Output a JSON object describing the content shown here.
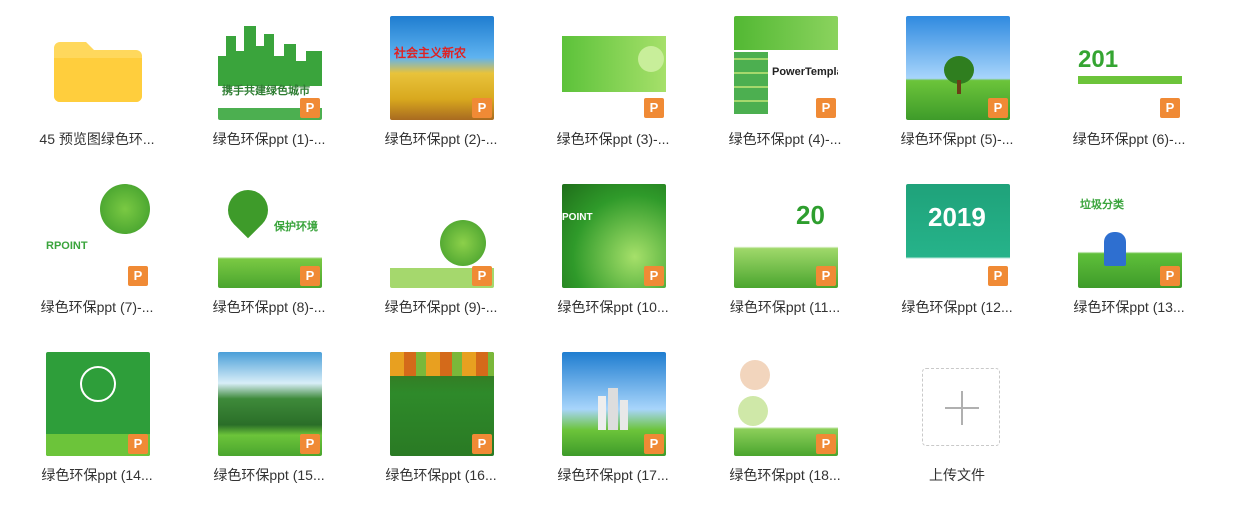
{
  "items": [
    {
      "label": "45 预览图绿色环...",
      "kind": "folder"
    },
    {
      "label": "绿色环保ppt (1)-...",
      "kind": "ppt",
      "overlay": "携手共建绿色城市"
    },
    {
      "label": "绿色环保ppt (2)-...",
      "kind": "ppt",
      "overlay": "社会主义新农"
    },
    {
      "label": "绿色环保ppt (3)-...",
      "kind": "ppt",
      "overlay": ""
    },
    {
      "label": "绿色环保ppt (4)-...",
      "kind": "ppt",
      "overlay": "PowerTempla"
    },
    {
      "label": "绿色环保ppt (5)-...",
      "kind": "ppt",
      "overlay": ""
    },
    {
      "label": "绿色环保ppt (6)-...",
      "kind": "ppt",
      "overlay": "201"
    },
    {
      "label": "绿色环保ppt (7)-...",
      "kind": "ppt",
      "overlay": "RPOINT"
    },
    {
      "label": "绿色环保ppt (8)-...",
      "kind": "ppt",
      "overlay": "保护环境"
    },
    {
      "label": "绿色环保ppt (9)-...",
      "kind": "ppt",
      "overlay": ""
    },
    {
      "label": "绿色环保ppt (10...",
      "kind": "ppt",
      "overlay": "POINT"
    },
    {
      "label": "绿色环保ppt (11...",
      "kind": "ppt",
      "overlay": "20"
    },
    {
      "label": "绿色环保ppt (12...",
      "kind": "ppt",
      "overlay": "2019"
    },
    {
      "label": "绿色环保ppt (13...",
      "kind": "ppt",
      "overlay": "垃圾分类"
    },
    {
      "label": "绿色环保ppt (14...",
      "kind": "ppt",
      "overlay": ""
    },
    {
      "label": "绿色环保ppt (15...",
      "kind": "ppt",
      "overlay": ""
    },
    {
      "label": "绿色环保ppt (16...",
      "kind": "ppt",
      "overlay": ""
    },
    {
      "label": "绿色环保ppt (17...",
      "kind": "ppt",
      "overlay": ""
    },
    {
      "label": "绿色环保ppt (18...",
      "kind": "ppt",
      "overlay": ""
    }
  ],
  "upload": {
    "label": "上传文件",
    "icon": "plus-icon"
  },
  "badge_letter": "P",
  "colors": {
    "badge": "#f08a35",
    "folder": "#ffd85c",
    "label_text": "#333333"
  }
}
